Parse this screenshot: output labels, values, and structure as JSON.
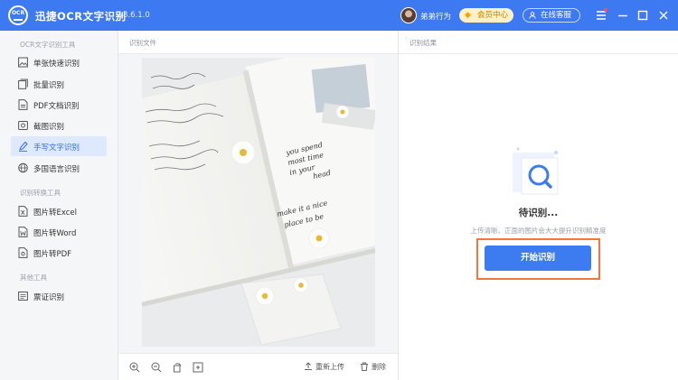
{
  "titlebar": {
    "app_title": "迅捷OCR文字识别",
    "version": "v8.6.1.0",
    "logo_text": "OCR",
    "username": "弟弟行为",
    "vip_label": "会员中心",
    "service_label": "在线客服"
  },
  "sidebar": {
    "groups": [
      {
        "title": "OCR文字识别工具",
        "items": [
          {
            "label": "单张快速识别",
            "icon": "image-icon"
          },
          {
            "label": "批量识别",
            "icon": "batch-icon"
          },
          {
            "label": "PDF文档识别",
            "icon": "pdf-icon"
          },
          {
            "label": "截图识别",
            "icon": "screenshot-icon"
          },
          {
            "label": "手写文字识别",
            "icon": "pen-icon",
            "active": true
          },
          {
            "label": "多国语言识别",
            "icon": "globe-icon"
          }
        ]
      },
      {
        "title": "识别转换工具",
        "items": [
          {
            "label": "图片转Excel",
            "icon": "excel-icon"
          },
          {
            "label": "图片转Word",
            "icon": "word-icon"
          },
          {
            "label": "图片转PDF",
            "icon": "pdf-convert-icon"
          }
        ]
      },
      {
        "title": "其他工具",
        "items": [
          {
            "label": "票证识别",
            "icon": "ticket-icon"
          }
        ]
      }
    ]
  },
  "center": {
    "header": "识别文件",
    "reupload_label": "重新上传",
    "delete_label": "删除",
    "handwriting": [
      "you spend",
      "most time",
      "in your",
      "head",
      "make it a nice",
      "place to be"
    ]
  },
  "right": {
    "header": "识别结果",
    "status_title": "待识别...",
    "hint": "上传清晰、正面的图片会大大提升识别精准度",
    "start_label": "开始识别"
  },
  "colors": {
    "brand": "#3d79f0",
    "active_bg": "#dfe9fd",
    "highlight_outline": "#f4763b"
  }
}
